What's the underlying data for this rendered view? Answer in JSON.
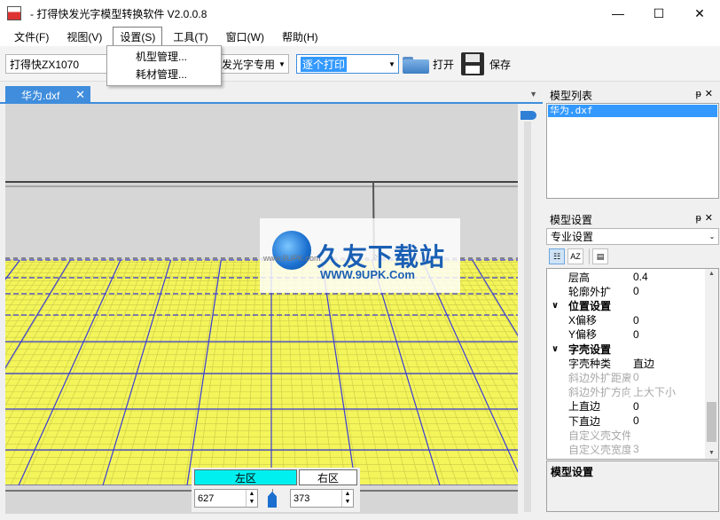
{
  "window": {
    "title": "- 打得快发光字模型转换软件 V2.0.0.8",
    "minimize": "—",
    "maximize": "☐",
    "close": "✕"
  },
  "menu": {
    "items": [
      "文件(F)",
      "视图(V)",
      "设置(S)",
      "工具(T)",
      "窗口(W)",
      "帮助(H)"
    ],
    "open_dropdown": [
      "机型管理...",
      "耗材管理..."
    ]
  },
  "toolbar": {
    "machine_combo": "打得快ZX1070",
    "type_combo": "发光字专用",
    "print_mode_combo": "逐个打印",
    "open_label": "打开",
    "save_label": "保存"
  },
  "tabs": {
    "document": "华为.dxf",
    "close": "✕"
  },
  "zone": {
    "left_label": "左区",
    "right_label": "右区",
    "left_value": "627",
    "right_value": "373"
  },
  "model_list": {
    "title": "模型列表",
    "items": [
      "华为.dxf"
    ]
  },
  "model_settings": {
    "title": "模型设置",
    "mode": "专业设置",
    "rows": [
      {
        "type": "prop",
        "key": "层高",
        "value": "0.4",
        "disabled": false
      },
      {
        "type": "prop",
        "key": "轮廓外扩",
        "value": "0",
        "disabled": false
      },
      {
        "type": "cat",
        "key": "位置设置"
      },
      {
        "type": "prop",
        "key": "X偏移",
        "value": "0",
        "disabled": false
      },
      {
        "type": "prop",
        "key": "Y偏移",
        "value": "0",
        "disabled": false
      },
      {
        "type": "cat",
        "key": "字壳设置"
      },
      {
        "type": "prop",
        "key": "字壳种类",
        "value": "直边",
        "disabled": false
      },
      {
        "type": "prop",
        "key": "斜边外扩距离",
        "value": "0",
        "disabled": true
      },
      {
        "type": "prop",
        "key": "斜边外扩方向",
        "value": "上大下小",
        "disabled": true
      },
      {
        "type": "prop",
        "key": "上直边",
        "value": "0",
        "disabled": false
      },
      {
        "type": "prop",
        "key": "下直边",
        "value": "0",
        "disabled": false
      },
      {
        "type": "prop",
        "key": "自定义壳文件",
        "value": "",
        "disabled": true
      },
      {
        "type": "prop",
        "key": "自定义壳宽度",
        "value": "3",
        "disabled": true
      }
    ],
    "description": "模型设置"
  },
  "watermark": {
    "title": "久友下载站",
    "url": "WWW.9UPK.Com",
    "small": "www.9UPK.com"
  },
  "colors": {
    "accent": "#3f8ddc",
    "bed": "#f4f55a",
    "grid_line": "#3b3bd8",
    "zone_active": "#00f0f0"
  }
}
